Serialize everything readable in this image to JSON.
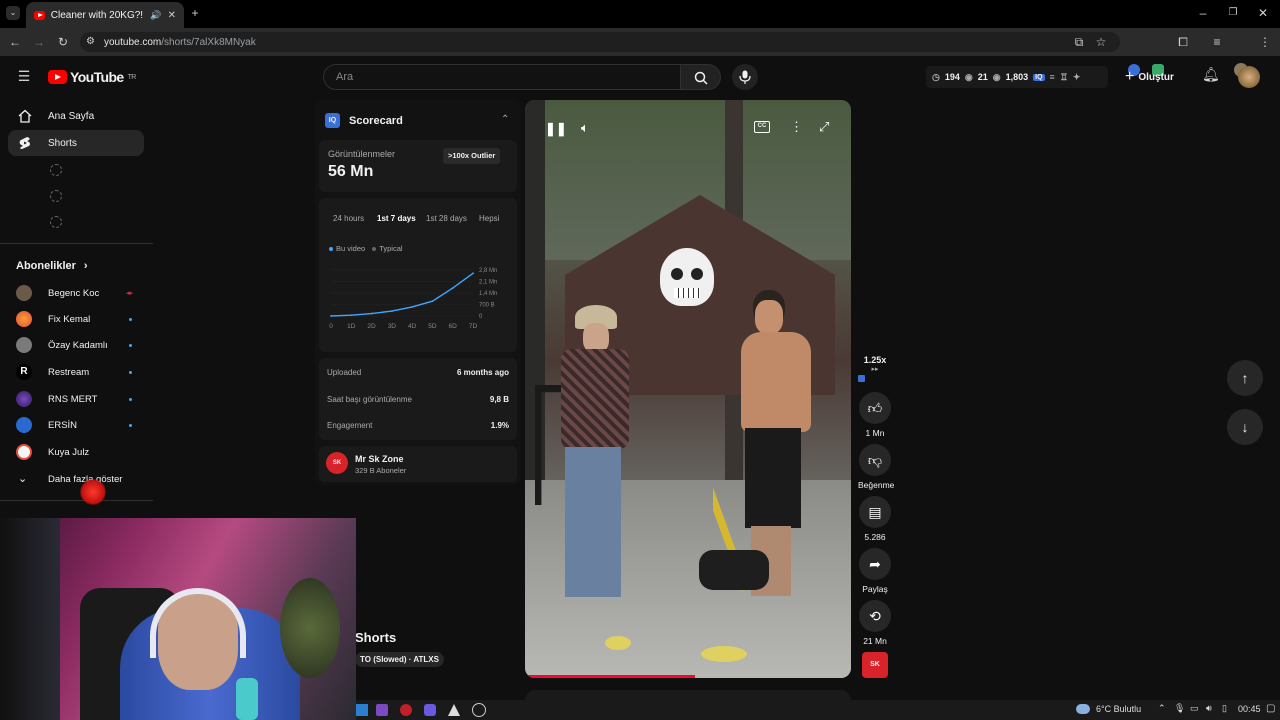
{
  "browser": {
    "tab_title": "Cleaner with 20KG?! 😲😨",
    "url_host": "youtube.com",
    "url_path": "/shorts/7alXk8MNyak"
  },
  "header": {
    "logo_text": "YouTube",
    "logo_region": "TR",
    "search_placeholder": "Ara",
    "stats": {
      "watch": "194",
      "views_a": "21",
      "views_b": "1,803"
    },
    "create_label": "Oluştur"
  },
  "sidebar": {
    "items": [
      {
        "label": "Ana Sayfa"
      },
      {
        "label": "Shorts"
      }
    ],
    "subscriptions_label": "Abonelikler",
    "channels": [
      {
        "name": "Begenc Koc",
        "avatar_color": "#6b5a4a"
      },
      {
        "name": "Fix Kemal",
        "avatar_color": "#e74c3c"
      },
      {
        "name": "Özay Kadamlı",
        "avatar_color": "#7a7a7a"
      },
      {
        "name": "Restream",
        "avatar_color": "#000000"
      },
      {
        "name": "RNS MERT",
        "avatar_color": "#4a2a8a"
      },
      {
        "name": "ERSİN",
        "avatar_color": "#2a6ad0"
      },
      {
        "name": "Kuya Julz",
        "avatar_color": "#f5f5f5"
      }
    ],
    "show_more_label": "Daha fazla göster"
  },
  "scorecard": {
    "title": "Scorecard",
    "views_label": "Görüntülenmeler",
    "views_value": "56 Mn",
    "outlier_badge": ">100x Outlier",
    "tabs": [
      "24 hours",
      "1st 7 days",
      "1st 28 days",
      "Hepsi"
    ],
    "active_tab": "1st 7 days",
    "legend": [
      "Bu video",
      "Typical"
    ],
    "rows": [
      {
        "label": "Uploaded",
        "value": "6 months ago"
      },
      {
        "label": "Saat başı görüntülenme",
        "value": "9,8 B"
      },
      {
        "label": "Engagement",
        "value": "1.9%"
      }
    ],
    "channel_name": "Mr Sk Zone",
    "channel_subs": "329 B Aboneler"
  },
  "chart_data": {
    "type": "line",
    "x": [
      "0",
      "1D",
      "2D",
      "3D",
      "4D",
      "5D",
      "6D",
      "7D"
    ],
    "y_ticks": [
      "2,8 Mn",
      "2,1 Mn",
      "1,4 Mn",
      "700 B",
      "0"
    ],
    "ylim": [
      0,
      2800000
    ],
    "series": [
      {
        "name": "Bu video",
        "values": [
          0,
          50000,
          150000,
          300000,
          550000,
          900000,
          1700000,
          2600000
        ],
        "color": "#3ea6ff"
      }
    ]
  },
  "video": {
    "speed": "1.25x",
    "like_count": "1 Mn",
    "dislike_label": "Beğenme",
    "comment_count": "5.286",
    "share_label": "Paylaş",
    "remix_count": "21 Mn",
    "overlay_title": "Shorts",
    "music": "TO (Slowed) · ATLXS"
  },
  "taskbar": {
    "weather": "6°C  Bulutlu",
    "time": "00:45"
  }
}
